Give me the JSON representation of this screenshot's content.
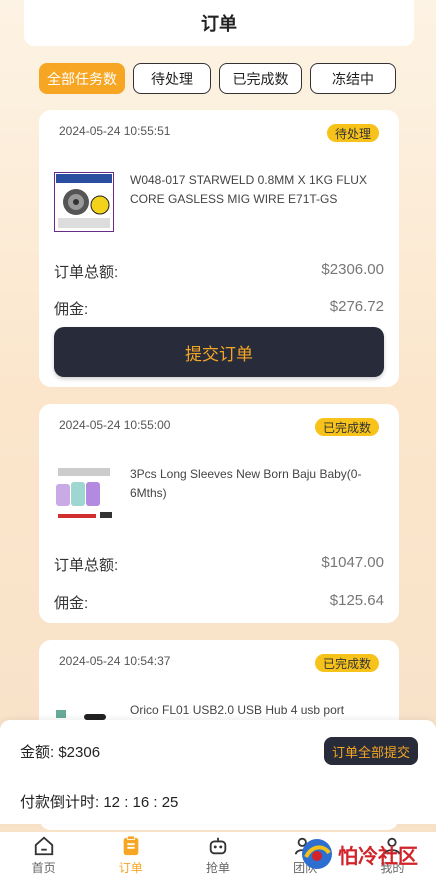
{
  "header": {
    "title": "订单"
  },
  "tabs": [
    {
      "label": "全部任务数",
      "active": true
    },
    {
      "label": "待处理",
      "active": false
    },
    {
      "label": "已完成数",
      "active": false
    },
    {
      "label": "冻结中",
      "active": false
    }
  ],
  "orders": [
    {
      "time": "2024-05-24 10:55:51",
      "status": "待处理",
      "product": "W048-017 STARWELD 0.8MM X 1KG FLUX CORE GASLESS MIG WIRE E71T-GS",
      "total_label": "订单总额:",
      "total": "$2306.00",
      "commission_label": "佣金:",
      "commission": "$276.72",
      "button": "提交订单"
    },
    {
      "time": "2024-05-24 10:55:00",
      "status": "已完成数",
      "product": "3Pcs Long Sleeves New Born Baju Baby(0-6Mths)",
      "total_label": "订单总额:",
      "total": "$1047.00",
      "commission_label": "佣金:",
      "commission": "$125.64"
    },
    {
      "time": "2024-05-24 10:54:37",
      "status": "已完成数",
      "product": "Orico FL01 USB2.0 USB Hub 4 usb port"
    }
  ],
  "footer": {
    "amount_label": "金额:",
    "amount": "$2306",
    "submit_all": "订单全部提交",
    "countdown_label": "付款倒计时:",
    "countdown": "12 : 16 : 25"
  },
  "nav": [
    {
      "label": "首页",
      "icon": "home-icon",
      "active": false
    },
    {
      "label": "订单",
      "icon": "order-icon",
      "active": true
    },
    {
      "label": "抢单",
      "icon": "robot-icon",
      "active": false
    },
    {
      "label": "团队",
      "icon": "team-icon",
      "active": false
    },
    {
      "label": "我的",
      "icon": "user-icon",
      "active": false
    }
  ],
  "watermark": {
    "text": "怕冷社区"
  },
  "colors": {
    "accent": "#f6a623",
    "dark_button": "#272b3a",
    "badge": "#f7c21a"
  }
}
